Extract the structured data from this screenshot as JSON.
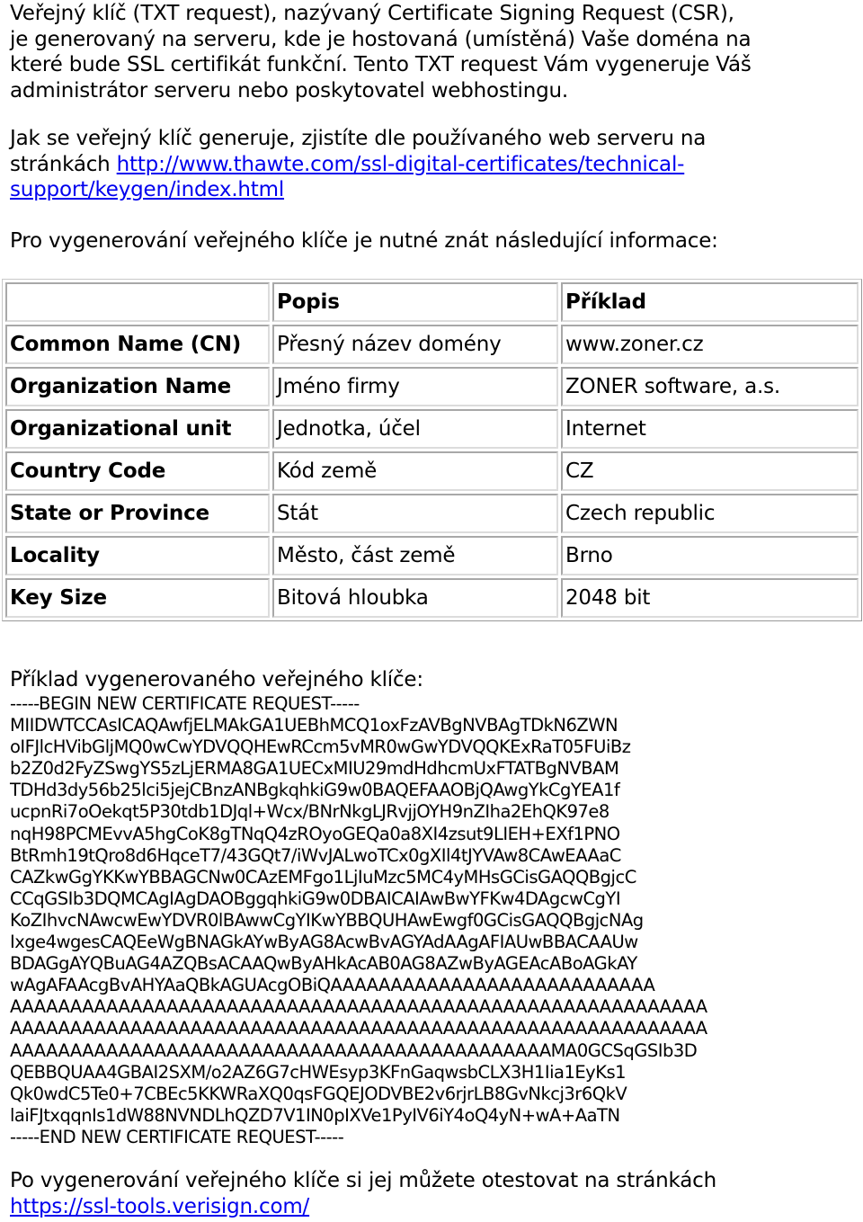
{
  "intro": {
    "lines": [
      "Veřejný klíč (TXT request), nazývaný Certificate Signing Request (CSR),",
      "je generovaný na serveru, kde je hostovaná (umístěná) Vaše doména na",
      "které bude SSL certifikát funkční. Tento TXT request Vám vygeneruje Váš",
      "administrátor serveru nebo poskytovatel webhostingu."
    ]
  },
  "howto": {
    "line1": "Jak se veřejný klíč generuje, zjistíte dle používaného web serveru na",
    "prefix": "stránkách ",
    "link_line1": "http://www.thawte.com/ssl-digital-certificates/technical-",
    "link_line2": "support/keygen/index.html"
  },
  "needinfo": "Pro vygenerování veřejného klíče je nutné znát následující informace:",
  "table": {
    "headers": [
      "",
      "Popis",
      "Příklad"
    ],
    "rows": [
      [
        "Common Name (CN)",
        "Přesný název domény",
        "www.zoner.cz"
      ],
      [
        "Organization Name",
        "Jméno firmy",
        "ZONER software, a.s."
      ],
      [
        "Organizational unit",
        "Jednotka, účel",
        "Internet"
      ],
      [
        "Country Code",
        "Kód země",
        "CZ"
      ],
      [
        "State or Province",
        "Stát",
        "Czech republic"
      ],
      [
        "Locality",
        "Město, část země",
        "Brno"
      ],
      [
        "Key Size",
        "Bitová hloubka",
        "2048 bit"
      ]
    ]
  },
  "example_title": "Příklad vygenerovaného veřejného klíče:",
  "csr_lines": [
    "-----BEGIN NEW CERTIFICATE REQUEST-----",
    "MIIDWTCCAsICAQAwfjELMAkGA1UEBhMCQ1oxFzAVBgNVBAgTDkN6ZWN",
    "oIFJlcHVibGljMQ0wCwYDVQQHEwRCcm5vMR0wGwYDVQQKExRaT05FUiBz",
    "b2Z0d2FyZSwgYS5zLjERMA8GA1UECxMIU29mdHdhcmUxFTATBgNVBAM",
    "TDHd3dy56b25lci5jejCBnzANBgkqhkiG9w0BAQEFAAOBjQAwgYkCgYEA1f",
    "ucpnRi7oOekqt5P30tdb1DJql+Wcx/BNrNkgLJRvjjOYH9nZIha2EhQK97e8",
    "nqH98PCMEvvA5hgCoK8gTNqQ4zROyoGEQa0a8XI4zsut9LIEH+EXf1PNO",
    "BtRmh19tQro8d6HqceT7/43GQt7/iWvJALwoTCx0gXIl4tJYVAw8CAwEAAaC",
    "CAZkwGgYKKwYBBAGCNw0CAzEMFgo1LjIuMzc5MC4yMHsGCisGAQQBgjcC",
    "CCqGSIb3DQMCAgIAgDAOBggqhkiG9w0DBAICAIAwBwYFKw4DAgcwCgYI",
    "KoZIhvcNAwcwEwYDVR0lBAwwCgYIKwYBBQUHAwEwgf0GCisGAQQBgjcNAg",
    "Ixge4wgesCAQEeWgBNAGkAYwByAG8AcwBvAGYAdAAgAFIAUwBBACAAUw",
    "BDAGgAYQBuAG4AZQBsACAAQwByAHkAcAB0AG8AZwByAGEAcABoAGkAY",
    "wAgAFAAcgBvAHYAaQBkAGUAcgOBiQAAAAAAAAAAAAAAAAAAAAAAAAAAA",
    "AAAAAAAAAAAAAAAAAAAAAAAAAAAAAAAAAAAAAAAAAAAAAAAAAAAAAAAAAA",
    "AAAAAAAAAAAAAAAAAAAAAAAAAAAAAAAAAAAAAAAAAAAAAAAAAAAAAAAAAA",
    "AAAAAAAAAAAAAAAAAAAAAAAAAAAAAAAAAAAAAAAAAAAAAMA0GCSqGSIb3D",
    "QEBBQUAA4GBAI2SXM/o2AZ6G7cHWEsyp3KFnGaqwsbCLX3H1Iia1EyKs1",
    "Qk0wdC5Te0+7CBEc5KKWRaXQ0qsFGQEJODVBE2v6rjrLB8GvNkcj3r6QkV",
    "laiFJtxqqnIs1dW88NVNDLhQZD7V1IN0pIXVe1PyIV6iY4oQ4yN+wA+AaTN",
    "-----END NEW CERTIFICATE REQUEST-----"
  ],
  "outro": {
    "line1": "Po vygenerování veřejného klíče si jej můžete otestovat na stránkách",
    "link": "https://ssl-tools.verisign.com/"
  }
}
